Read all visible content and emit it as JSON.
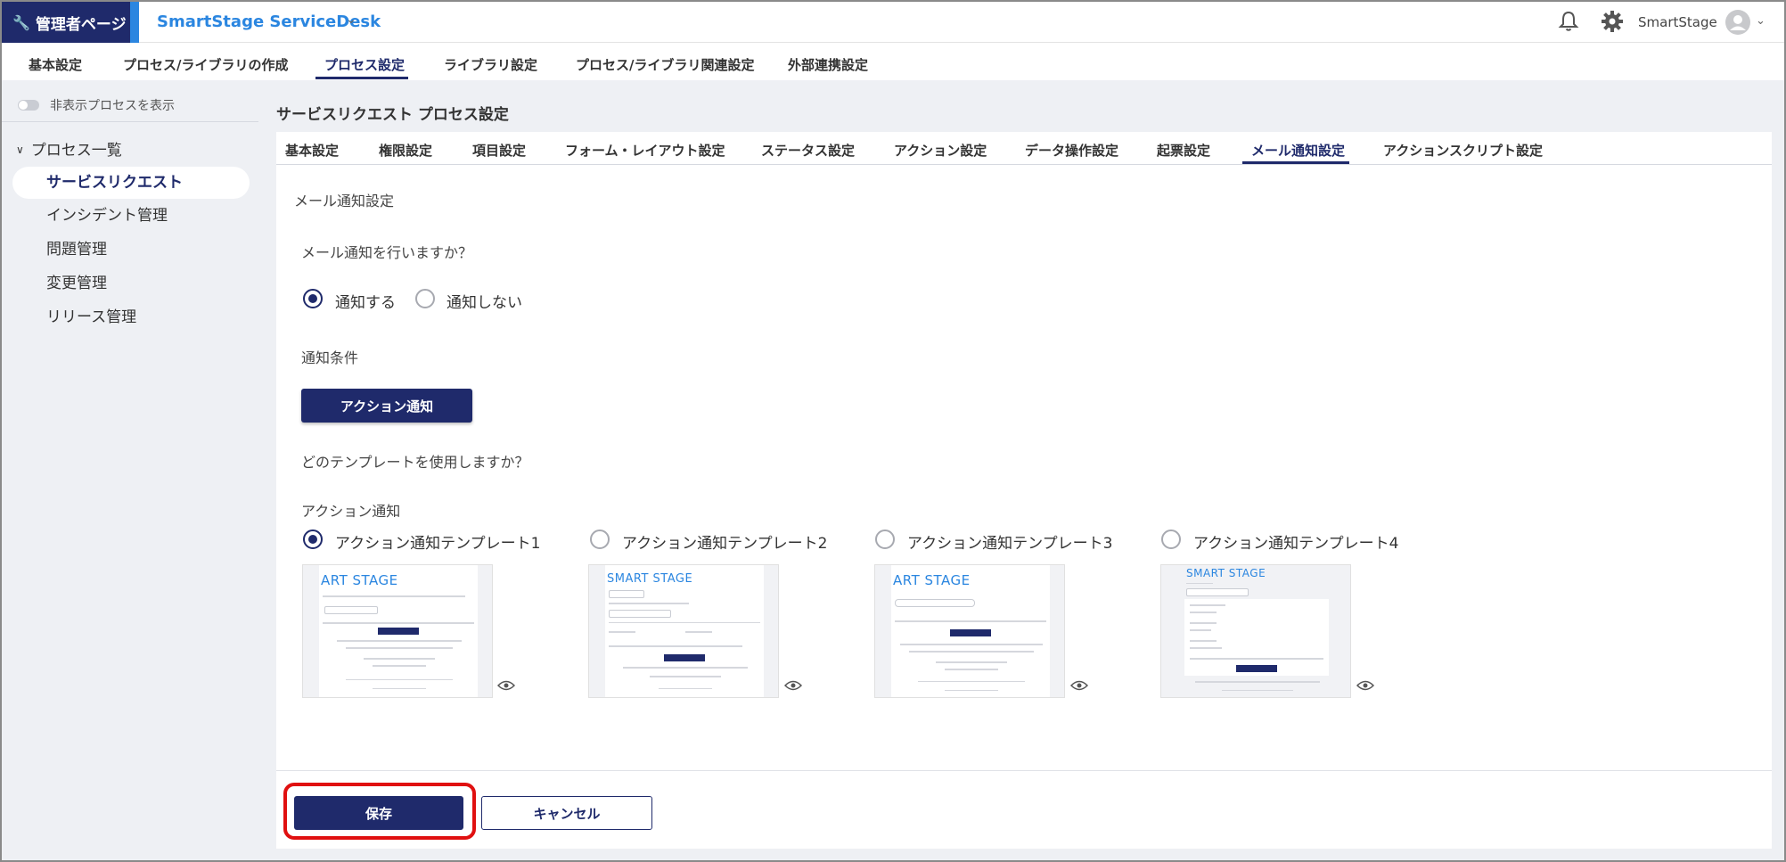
{
  "header": {
    "admin_label": "管理者ページ",
    "app_title": "SmartStage ServiceDesk",
    "user_name": "SmartStage"
  },
  "main_nav": {
    "items": [
      {
        "label": "基本設定"
      },
      {
        "label": "プロセス/ライブラリの作成"
      },
      {
        "label": "プロセス設定"
      },
      {
        "label": "ライブラリ設定"
      },
      {
        "label": "プロセス/ライブラリ関連設定"
      },
      {
        "label": "外部連携設定"
      }
    ],
    "active": "プロセス設定"
  },
  "sidebar": {
    "toggle_label": "非表示プロセスを表示",
    "toggle_on": false,
    "section_title": "プロセス一覧",
    "items": [
      {
        "label": "サービスリクエスト"
      },
      {
        "label": "インシデント管理"
      },
      {
        "label": "問題管理"
      },
      {
        "label": "変更管理"
      },
      {
        "label": "リリース管理"
      }
    ],
    "active": "サービスリクエスト"
  },
  "page": {
    "title": "サービスリクエスト プロセス設定",
    "tabs": [
      {
        "label": "基本設定"
      },
      {
        "label": "権限設定"
      },
      {
        "label": "項目設定"
      },
      {
        "label": "フォーム・レイアウト設定"
      },
      {
        "label": "ステータス設定"
      },
      {
        "label": "アクション設定"
      },
      {
        "label": "データ操作設定"
      },
      {
        "label": "起票設定"
      },
      {
        "label": "メール通知設定"
      },
      {
        "label": "アクションスクリプト設定"
      }
    ],
    "active_tab": "メール通知設定"
  },
  "mail_settings": {
    "section_title": "メール通知設定",
    "question_notify": "メール通知を行いますか？",
    "notify_options": [
      {
        "label": "通知する",
        "checked": true
      },
      {
        "label": "通知しない",
        "checked": false
      }
    ],
    "condition_label": "通知条件",
    "condition_button": "アクション通知",
    "question_template": "どのテンプレートを使用しますか？",
    "template_group_label": "アクション通知",
    "templates": [
      {
        "label": "アクション通知テンプレート1",
        "checked": true,
        "logo": "ART STAGE"
      },
      {
        "label": "アクション通知テンプレート2",
        "checked": false,
        "logo": "SMART STAGE"
      },
      {
        "label": "アクション通知テンプレート3",
        "checked": false,
        "logo": "ART STAGE"
      },
      {
        "label": "アクション通知テンプレート4",
        "checked": false,
        "logo": "SMART STAGE"
      }
    ]
  },
  "footer": {
    "save_label": "保存",
    "cancel_label": "キャンセル"
  },
  "colors": {
    "primary": "#1f2a6b",
    "accent_blue": "#2b86e0",
    "highlight_red": "#e01010",
    "background": "#eef0f4"
  }
}
